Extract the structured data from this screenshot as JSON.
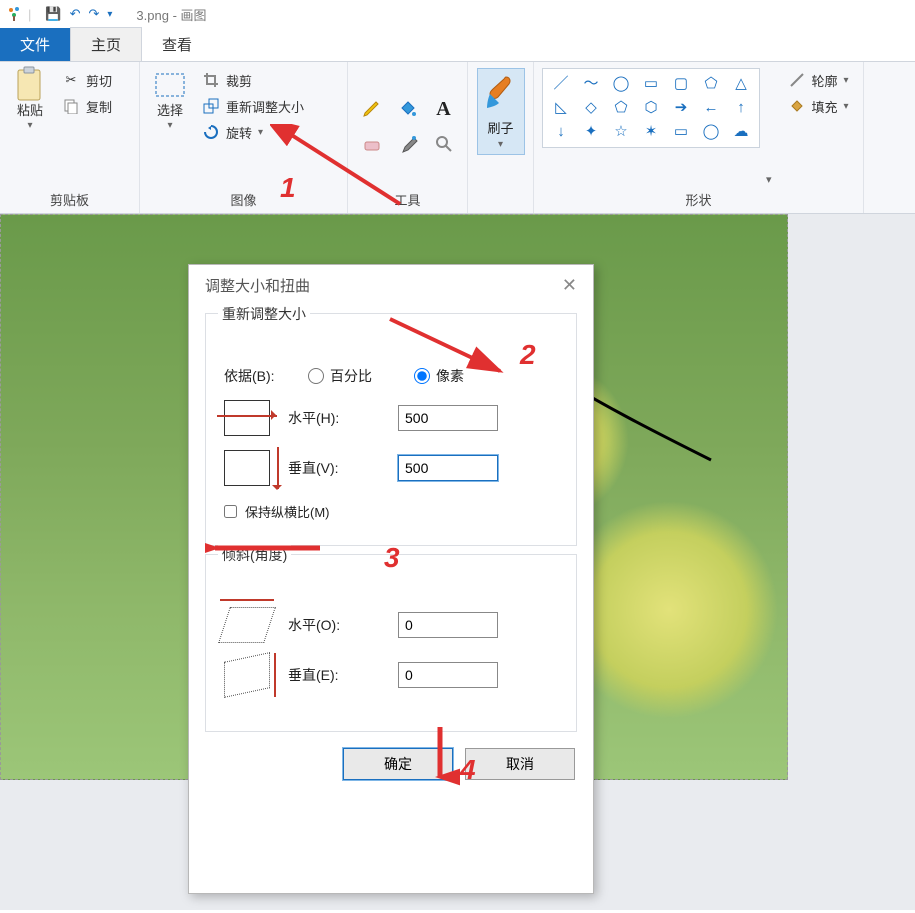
{
  "app": {
    "title": "3.png - 画图"
  },
  "qat": {
    "save": "💾",
    "undo": "↶",
    "redo": "↷",
    "customize": "▾"
  },
  "tabs": {
    "file": "文件",
    "home": "主页",
    "view": "查看"
  },
  "ribbon": {
    "clipboard": {
      "paste": "粘贴",
      "cut": "剪切",
      "copy": "复制",
      "group": "剪贴板"
    },
    "image": {
      "select": "选择",
      "crop": "裁剪",
      "resize": "重新调整大小",
      "rotate": "旋转",
      "group": "图像"
    },
    "tools": {
      "group": "工具"
    },
    "brush": {
      "label": "刷子"
    },
    "shapes": {
      "outline": "轮廓",
      "fill": "填充",
      "group": "形状"
    }
  },
  "dialog": {
    "title": "调整大小和扭曲",
    "resize_legend": "重新调整大小",
    "by_label": "依据(B):",
    "percent": "百分比",
    "pixels": "像素",
    "horizontal": "水平(H):",
    "vertical": "垂直(V):",
    "h_value": "500",
    "v_value": "500",
    "keep_aspect": "保持纵横比(M)",
    "skew_legend": "倾斜(角度)",
    "skew_h_label": "水平(O):",
    "skew_v_label": "垂直(E):",
    "skew_h_value": "0",
    "skew_v_value": "0",
    "ok": "确定",
    "cancel": "取消"
  },
  "annotations": {
    "n1": "1",
    "n2": "2",
    "n3": "3",
    "n4": "4"
  }
}
